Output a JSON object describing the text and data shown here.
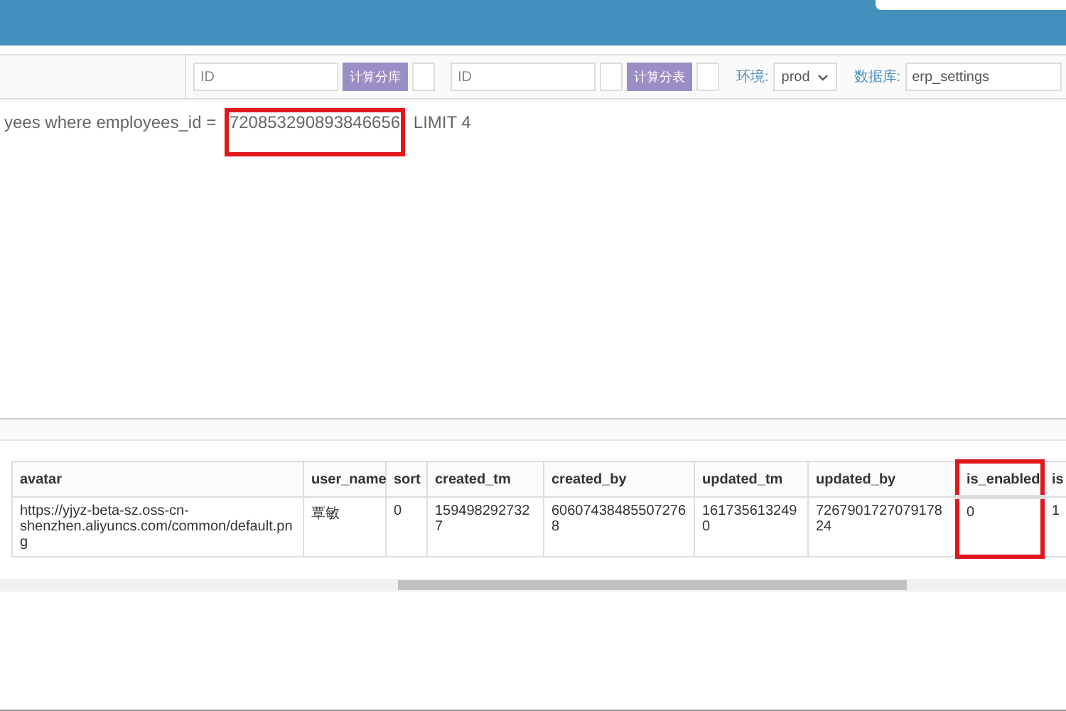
{
  "toolbar": {
    "shard_db": {
      "placeholder": "ID",
      "button": "计算分库"
    },
    "shard_table": {
      "placeholder": "ID",
      "button": "计算分表"
    },
    "env_label": "环境:",
    "env": "prod",
    "db_label": "数据库:",
    "db": "erp_settings"
  },
  "query": [
    {
      "text": "yees where employees_id = ",
      "highlighted": false
    },
    {
      "text": "720853290893846656",
      "highlighted": true
    },
    {
      "text": " LIMIT 4",
      "highlighted": false
    }
  ],
  "table": {
    "columns": [
      {
        "label": "avatar",
        "highlighted": false
      },
      {
        "label": "user_name",
        "highlighted": false
      },
      {
        "label": "sort",
        "highlighted": false
      },
      {
        "label": "created_tm",
        "highlighted": false
      },
      {
        "label": "created_by",
        "highlighted": false
      },
      {
        "label": "updated_tm",
        "highlighted": false
      },
      {
        "label": "updated_by",
        "highlighted": false
      },
      {
        "label": "is_enabled",
        "highlighted": true
      },
      {
        "label": "is",
        "highlighted": false
      }
    ],
    "rows": [
      [
        "https://yjyz-beta-sz.oss-cn-shenzhen.aliyuncs.com/common/default.png",
        "覃敏",
        "0",
        "1594982927327",
        "606074384855072768",
        "1617356132490",
        "726790172707917824",
        "0",
        "1"
      ]
    ]
  }
}
